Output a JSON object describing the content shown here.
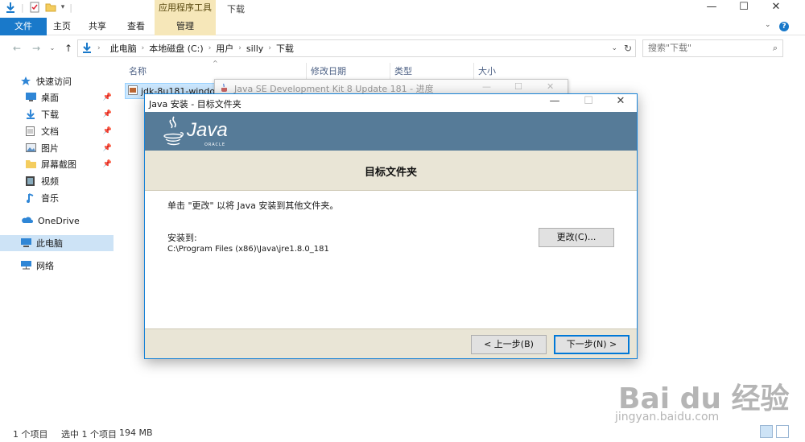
{
  "titlebar": {
    "contextual_tab": "应用程序工具",
    "window_title": "下载",
    "minimize": "—",
    "maximize": "☐",
    "close": "✕"
  },
  "ribbon": {
    "tabs": [
      "文件",
      "主页",
      "共享",
      "查看",
      "管理"
    ]
  },
  "address": {
    "segments": [
      "此电脑",
      "本地磁盘 (C:)",
      "用户",
      "silly",
      "下载"
    ],
    "search_placeholder": "搜索\"下载\""
  },
  "sidebar": {
    "items": [
      {
        "label": "快速访问",
        "icon": "star-icon"
      },
      {
        "label": "桌面",
        "icon": "desktop-icon",
        "pinned": true
      },
      {
        "label": "下载",
        "icon": "download-icon",
        "pinned": true
      },
      {
        "label": "文档",
        "icon": "document-icon",
        "pinned": true
      },
      {
        "label": "图片",
        "icon": "picture-icon",
        "pinned": true
      },
      {
        "label": "屏幕截图",
        "icon": "folder-icon",
        "pinned": true
      },
      {
        "label": "视频",
        "icon": "video-icon"
      },
      {
        "label": "音乐",
        "icon": "music-icon"
      },
      {
        "label": "OneDrive",
        "icon": "cloud-icon"
      },
      {
        "label": "此电脑",
        "icon": "computer-icon",
        "selected": true
      },
      {
        "label": "网络",
        "icon": "network-icon"
      }
    ]
  },
  "filelist": {
    "columns": [
      "名称",
      "修改日期",
      "类型",
      "大小"
    ],
    "row_name": "jdk-8u181-window"
  },
  "bg_window": {
    "title": "Java SE Development Kit 8 Update 181 - 进度"
  },
  "dialog": {
    "title": "Java 安装 - 目标文件夹",
    "logo_text": "Java",
    "logo_sub": "ORACLE",
    "heading": "目标文件夹",
    "message": "单击 \"更改\" 以将 Java 安装到其他文件夹。",
    "install_label": "安装到:",
    "install_path": "C:\\Program Files (x86)\\Java\\jre1.8.0_181",
    "change_button": "更改(C)...",
    "back_button": "< 上一步(B)",
    "next_button": "下一步(N) >"
  },
  "status": {
    "items_count": "1 个项目",
    "selected": "选中 1 个项目",
    "size": "194 MB"
  },
  "watermark": {
    "brand": "Bai du 经验",
    "url": "jingyan.baidu.com"
  },
  "colors": {
    "accent": "#1979ca",
    "contextual": "#f6e7b9",
    "java_banner": "#567b98",
    "dialog_panel": "#e9e5d6"
  }
}
